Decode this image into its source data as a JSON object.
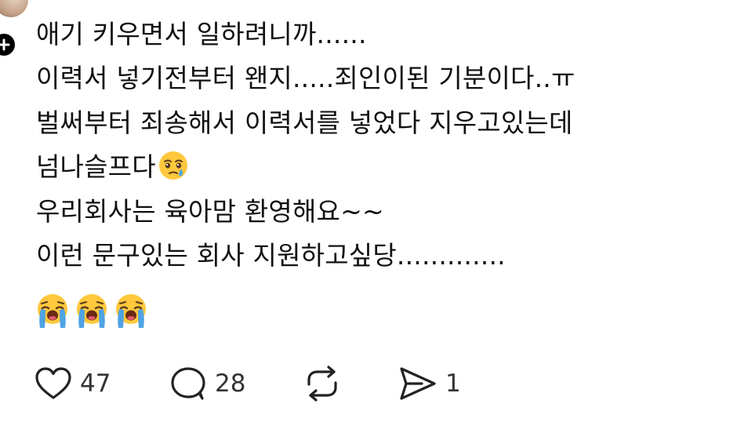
{
  "post": {
    "lines": [
      "애기 키우면서 일하려니까......",
      "이력서 넣기전부터 왠지.....죄인이된 기분이다..ㅠ",
      "벌써부터 죄송해서 이력서를 넣었다 지우고있는데",
      "넘나슬프다",
      "우리회사는 육아맘 환영해요~~",
      "이런 문구있는 회사 지원하고싶당............."
    ],
    "inline_emoji": "face-holding-back-tears",
    "trailing_emojis": [
      "loudly-crying-face",
      "loudly-crying-face",
      "loudly-crying-face"
    ]
  },
  "actions": {
    "likes": "47",
    "replies": "28",
    "shares": "1"
  },
  "icons": {
    "like": "heart-icon",
    "reply": "speech-bubble-icon",
    "repost": "repost-icon",
    "share": "send-icon",
    "follow": "plus-icon"
  },
  "colors": {
    "text": "#111111",
    "count": "#333333",
    "badge": "#000000",
    "emoji_face": "#FFC83D",
    "emoji_tears": "#4FA3E3"
  }
}
